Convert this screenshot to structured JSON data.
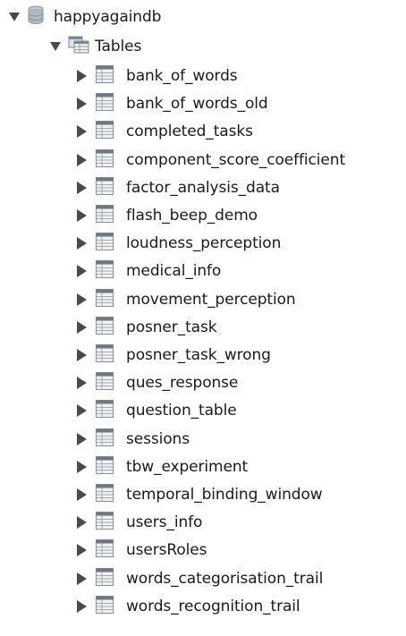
{
  "tree": {
    "database": {
      "name": "happyagaindb",
      "icon": "database-icon",
      "expanded": true
    },
    "folder": {
      "label": "Tables",
      "icon": "tables-folder-icon",
      "expanded": true
    },
    "tables": [
      {
        "name": "bank_of_words"
      },
      {
        "name": "bank_of_words_old"
      },
      {
        "name": "completed_tasks"
      },
      {
        "name": "component_score_coefficient"
      },
      {
        "name": "factor_analysis_data"
      },
      {
        "name": "flash_beep_demo"
      },
      {
        "name": "loudness_perception"
      },
      {
        "name": "medical_info"
      },
      {
        "name": "movement_perception"
      },
      {
        "name": "posner_task"
      },
      {
        "name": "posner_task_wrong"
      },
      {
        "name": "ques_response"
      },
      {
        "name": "question_table"
      },
      {
        "name": "sessions"
      },
      {
        "name": "tbw_experiment"
      },
      {
        "name": "temporal_binding_window"
      },
      {
        "name": "users_info"
      },
      {
        "name": "usersRoles"
      },
      {
        "name": "words_categorisation_trail"
      },
      {
        "name": "words_recognition_trail"
      }
    ]
  },
  "colors": {
    "arrow": "#4a4a4a",
    "table_icon_fill": "#eef0f2",
    "table_icon_line": "#8a9099",
    "table_icon_header": "#6f7782",
    "db_icon": "#9aa3ad",
    "folder_icon": "#7c8896"
  }
}
